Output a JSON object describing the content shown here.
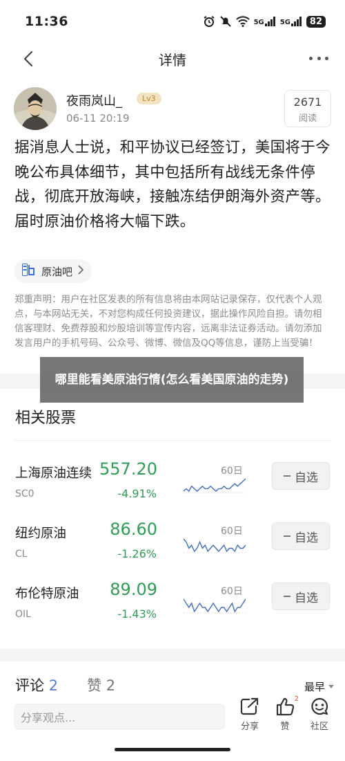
{
  "status_bar": {
    "time": "11:36",
    "network": "5G",
    "network2": "5G",
    "battery": "82"
  },
  "nav": {
    "title": "详情"
  },
  "author": {
    "name": "夜雨岚山_",
    "level": "Lv3",
    "time": "06-11 20:19",
    "read_count": "2671",
    "read_label": "阅读"
  },
  "post": {
    "text": "据消息人士说，和平协议已经签订，美国将于今晚公布具体细节，其中包括所有战线无条件停战，彻底开放海峡，接触冻结伊朗海外资产等。届时原油价格将大幅下跌。"
  },
  "topic": {
    "icon_text": "吧",
    "label": "原油吧"
  },
  "disclaimer": "郑重声明：用户在社区发表的所有信息将由本网站记录保存，仅代表个人观点，与本网站无关，不对您构成任何投资建议，据此操作风险自担。请勿相信客理财、免费荐股和炒股培训等宣传内容，远离非法证券活动。请勿添加发言用户的手机号码、公众号、微博、微信及QQ等信息，谨防上当受骗！",
  "overlay": {
    "text": "哪里能看美原油行情(怎么看美国原油的走势)"
  },
  "stocks": {
    "title": "相关股票",
    "add_label": "自选",
    "items": [
      {
        "name": "上海原油连续",
        "code": "SC0",
        "price": "557.20",
        "change": "-4.91%",
        "period": "60日",
        "spark": [
          5,
          6,
          5,
          7,
          6,
          5,
          6,
          7,
          6,
          6,
          7,
          6,
          5,
          6,
          6,
          7,
          6,
          6,
          7,
          8,
          7,
          8,
          9,
          10
        ]
      },
      {
        "name": "纽约原油",
        "code": "CL",
        "price": "86.60",
        "change": "-1.26%",
        "period": "60日",
        "spark": [
          9,
          8,
          6,
          7,
          5,
          6,
          8,
          6,
          7,
          5,
          6,
          7,
          6,
          5,
          6,
          7,
          5,
          6,
          6,
          5,
          7,
          6,
          6,
          7
        ]
      },
      {
        "name": "布伦特原油",
        "code": "OIL",
        "price": "89.09",
        "change": "-1.43%",
        "period": "60日",
        "spark": [
          8,
          7,
          6,
          7,
          5,
          6,
          7,
          6,
          6,
          5,
          6,
          7,
          6,
          5,
          6,
          6,
          5,
          6,
          7,
          5,
          6,
          6,
          7,
          8
        ]
      }
    ]
  },
  "comments": {
    "tab_label": "评论",
    "tab_count": "2",
    "like_label": "赞",
    "like_count": "2",
    "sort_label": "最早"
  },
  "bottom_bar": {
    "placeholder": "分享观点...",
    "share_label": "分享",
    "like_label": "赞",
    "like_badge": "2",
    "community_label": "社区"
  },
  "colors": {
    "down_green": "#2e9d55",
    "accent_blue": "#4f7fd0",
    "level_gold": "#b9852d"
  }
}
